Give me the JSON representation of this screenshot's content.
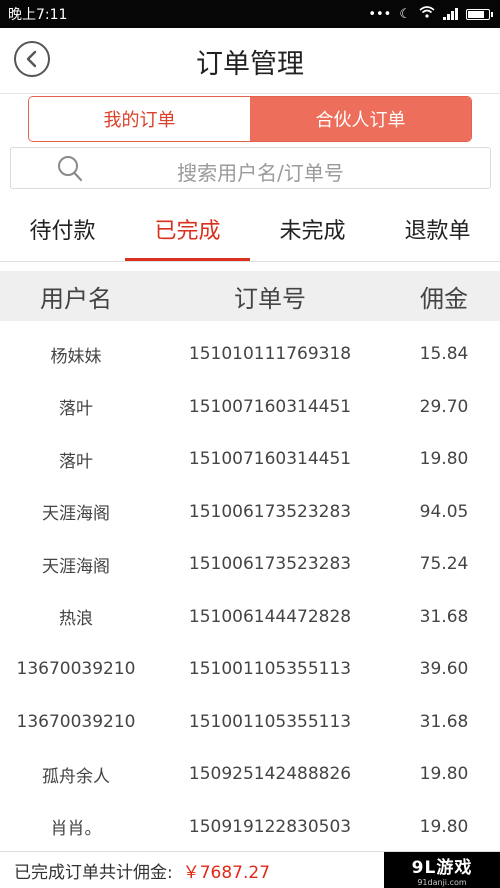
{
  "status_bar": {
    "time": "晚上7:11",
    "signal_icon": "signal-icon",
    "battery_icon": "battery-icon"
  },
  "header": {
    "title": "订单管理",
    "back_icon": "back-arrow-icon"
  },
  "segment": {
    "options": [
      "我的订单",
      "合伙人订单"
    ],
    "selected": "合伙人订单"
  },
  "search": {
    "placeholder": "搜索用户名/订单号",
    "icon": "search-icon"
  },
  "tabs": {
    "items": [
      "待付款",
      "已完成",
      "未完成",
      "退款单"
    ],
    "active": "已完成"
  },
  "table": {
    "headers": [
      "用户名",
      "订单号",
      "佣金"
    ],
    "rows": [
      [
        "杨妹妹",
        "151010111769318",
        "15.84"
      ],
      [
        "落叶",
        "151007160314451",
        "29.70"
      ],
      [
        "落叶",
        "151007160314451",
        "19.80"
      ],
      [
        "天涯海阁",
        "151006173523283",
        "94.05"
      ],
      [
        "天涯海阁",
        "151006173523283",
        "75.24"
      ],
      [
        "热浪",
        "151006144472828",
        "31.68"
      ],
      [
        "13670039210",
        "151001105355113",
        "39.60"
      ],
      [
        "13670039210",
        "151001105355113",
        "31.68"
      ],
      [
        "孤舟余人",
        "150925142488826",
        "19.80"
      ],
      [
        "肖肖。",
        "150919122830503",
        "19.80"
      ]
    ]
  },
  "footer": {
    "label": "已完成订单共计佣金:",
    "amount": "￥7687.27"
  },
  "watermark": {
    "logo_text": "9L游戏",
    "site": "91danji.com"
  },
  "colors": {
    "accent": "#d9311e",
    "segment_active": "#ee6e5c"
  }
}
